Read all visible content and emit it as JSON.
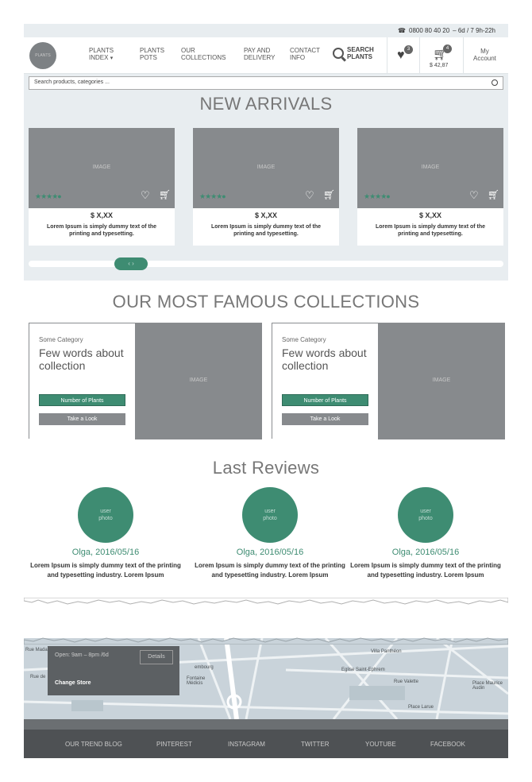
{
  "topbar": {
    "phone_icon": "phone-icon",
    "phone": "0800 80 40 20",
    "hours": "– 6d / 7 9h-22h"
  },
  "nav": {
    "logo": "PLANTS",
    "items": [
      {
        "line1": "PLANTS",
        "line2": "INDEX"
      },
      {
        "line1": "PLANTS",
        "line2": "POTS"
      },
      {
        "line1": "OUR",
        "line2": "COLLECTIONS"
      },
      {
        "line1": "PAY AND",
        "line2": "DELIVERY"
      },
      {
        "line1": "CONTACT",
        "line2": "INFO"
      }
    ],
    "search_line1": "SEARCH",
    "search_line2": "PLANTS",
    "wishlist_count": "3",
    "cart_count": "4",
    "cart_total": "$ 42,87",
    "account_line1": "My",
    "account_line2": "Account"
  },
  "search": {
    "placeholder": "Search products, categories ..."
  },
  "arrivals": {
    "title": "NEW ARRIVALS",
    "products": [
      {
        "image": "IMAGE",
        "stars": "★★★★●",
        "rating_filled": 4,
        "price": "$ X,XX",
        "desc": "Lorem Ipsum is simply dummy text of the printing and typesetting."
      },
      {
        "image": "IMAGE",
        "stars": "★★★★●",
        "rating_filled": 4,
        "price": "$ X,XX",
        "desc": "Lorem Ipsum is simply dummy text of the printing and typesetting."
      },
      {
        "image": "IMAGE",
        "stars": "★★★★●",
        "rating_filled": 4,
        "price": "$ X,XX",
        "desc": "Lorem Ipsum is simply dummy text of the printing and typesetting."
      }
    ],
    "slider_label": "‹ ›"
  },
  "collections": {
    "title": "OUR MOST FAMOUS COLLECTIONS",
    "cards": [
      {
        "category": "Some Category",
        "headline": "Few words about collection",
        "button1": "Number of Plants",
        "button2": "Take a Look",
        "image": "IMAGE"
      },
      {
        "category": "Some Category",
        "headline": "Few words about collection",
        "button1": "Number of Plants",
        "button2": "Take a Look",
        "image": "IMAGE"
      }
    ]
  },
  "reviews": {
    "title": "Last Reviews",
    "items": [
      {
        "photo_line1": "user",
        "photo_line2": "photo",
        "author": "Olga, 2016/05/16",
        "text": "Lorem Ipsum is simply dummy text of the printing and typesetting industry. Lorem Ipsum"
      },
      {
        "photo_line1": "user",
        "photo_line2": "photo",
        "author": "Olga, 2016/05/16",
        "text": "Lorem Ipsum is simply dummy text of the printing and typesetting industry. Lorem Ipsum"
      },
      {
        "photo_line1": "user",
        "photo_line2": "photo",
        "author": "Olga, 2016/05/16",
        "text": "Lorem Ipsum is simply dummy text of the printing and typesetting industry. Lorem Ipsum"
      }
    ]
  },
  "store": {
    "hours": "Open: 9am – 8pm /6d",
    "details": "Details",
    "change": "Change Store",
    "map_labels": [
      "Villa Panthéon",
      "Eglise Saint-Ephrem",
      "Fontaine Médicis",
      "Place Maurice Audin",
      "Place Larue",
      "Rue de",
      "Rue Madame",
      "embourg",
      "Rue Valette"
    ]
  },
  "footer": {
    "links": [
      "OUR TREND BLOG",
      "PINTEREST",
      "INSTAGRAM",
      "TWITTER",
      "YOUTUBE",
      "FACEBOOK"
    ]
  },
  "colors": {
    "accent": "#3e8c72",
    "placeholder_gray": "#878a8d",
    "panel_bg": "#e8edf0",
    "footer_bg": "#4e5154"
  }
}
